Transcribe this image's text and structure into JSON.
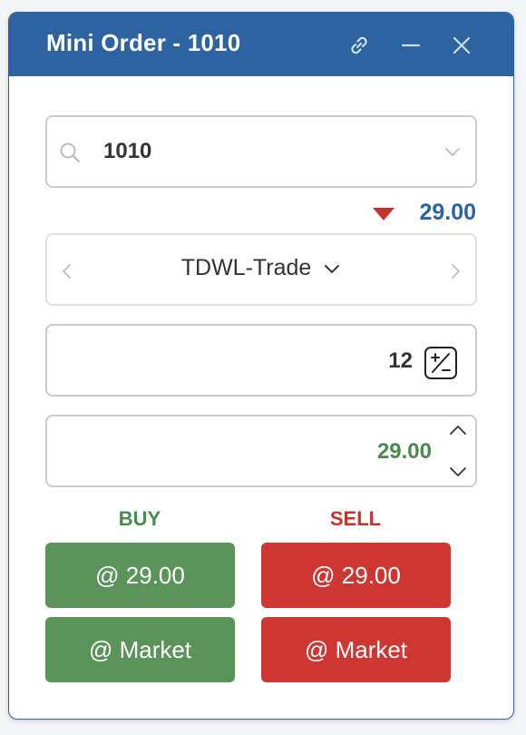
{
  "window": {
    "title": "Mini Order - 1010"
  },
  "titlebar": {
    "icons": [
      "link-icon",
      "minimize-icon",
      "close-icon"
    ]
  },
  "symbol": {
    "value": "1010"
  },
  "last_price": {
    "value": "29.00",
    "direction": "down"
  },
  "exchange": {
    "label": "TDWL-Trade"
  },
  "quantity": {
    "value": "12"
  },
  "limit_price": {
    "value": "29.00"
  },
  "buy": {
    "label": "BUY",
    "price_button": "@ 29.00",
    "market_button": "@ Market"
  },
  "sell": {
    "label": "SELL",
    "price_button": "@ 29.00",
    "market_button": "@ Market"
  },
  "colors": {
    "header": "#2c63a0",
    "buy": "#5a9459",
    "sell": "#cf3531",
    "buy_text": "#4b8a4f",
    "sell_text": "#c8322e"
  }
}
